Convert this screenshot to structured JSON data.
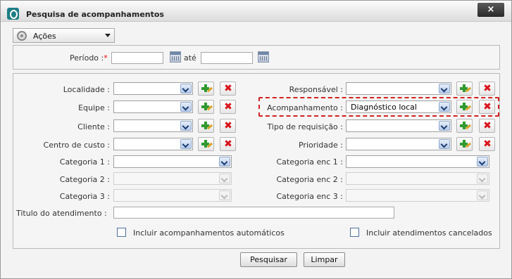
{
  "window": {
    "title": "Pesquisa de acompanhamentos",
    "close_label": "×"
  },
  "acoes": {
    "label": "Ações"
  },
  "periodo": {
    "label": "Período :",
    "required": "*",
    "from_value": "",
    "until_label": "até",
    "to_value": ""
  },
  "left_fields": {
    "localidade": {
      "label": "Localidade :",
      "value": ""
    },
    "equipe": {
      "label": "Equipe :",
      "value": ""
    },
    "cliente": {
      "label": "Cliente :",
      "value": ""
    },
    "centro_custo": {
      "label": "Centro de custo :",
      "value": ""
    },
    "categoria1": {
      "label": "Categoria 1 :",
      "value": ""
    },
    "categoria2": {
      "label": "Categoria 2 :",
      "value": ""
    },
    "categoria3": {
      "label": "Categoria 3 :",
      "value": ""
    }
  },
  "right_fields": {
    "responsavel": {
      "label": "Responsável :",
      "value": ""
    },
    "acompanhamento": {
      "label": "Acompanhamento :",
      "value": "Diagnóstico local"
    },
    "tipo_requisicao": {
      "label": "Tipo de requisição :",
      "value": ""
    },
    "prioridade": {
      "label": "Prioridade :",
      "value": ""
    },
    "categoria_enc1": {
      "label": "Categoria enc 1 :",
      "value": ""
    },
    "categoria_enc2": {
      "label": "Categoria enc 2 :",
      "value": ""
    },
    "categoria_enc3": {
      "label": "Categoria enc 3 :",
      "value": ""
    }
  },
  "titulo": {
    "label": "Titulo do atendimento :",
    "value": ""
  },
  "checkboxes": {
    "automaticos": "Incluir acompanhamentos automáticos",
    "cancelados": "Incluir atendimentos cancelados"
  },
  "buttons": {
    "pesquisar": "Pesquisar",
    "limpar": "Limpar"
  },
  "icons": {
    "add": "green-plus-icon",
    "remove": "red-x-icon",
    "calendar": "calendar-icon"
  },
  "colors": {
    "highlight": "#d12222",
    "accent": "#1d7d86"
  }
}
